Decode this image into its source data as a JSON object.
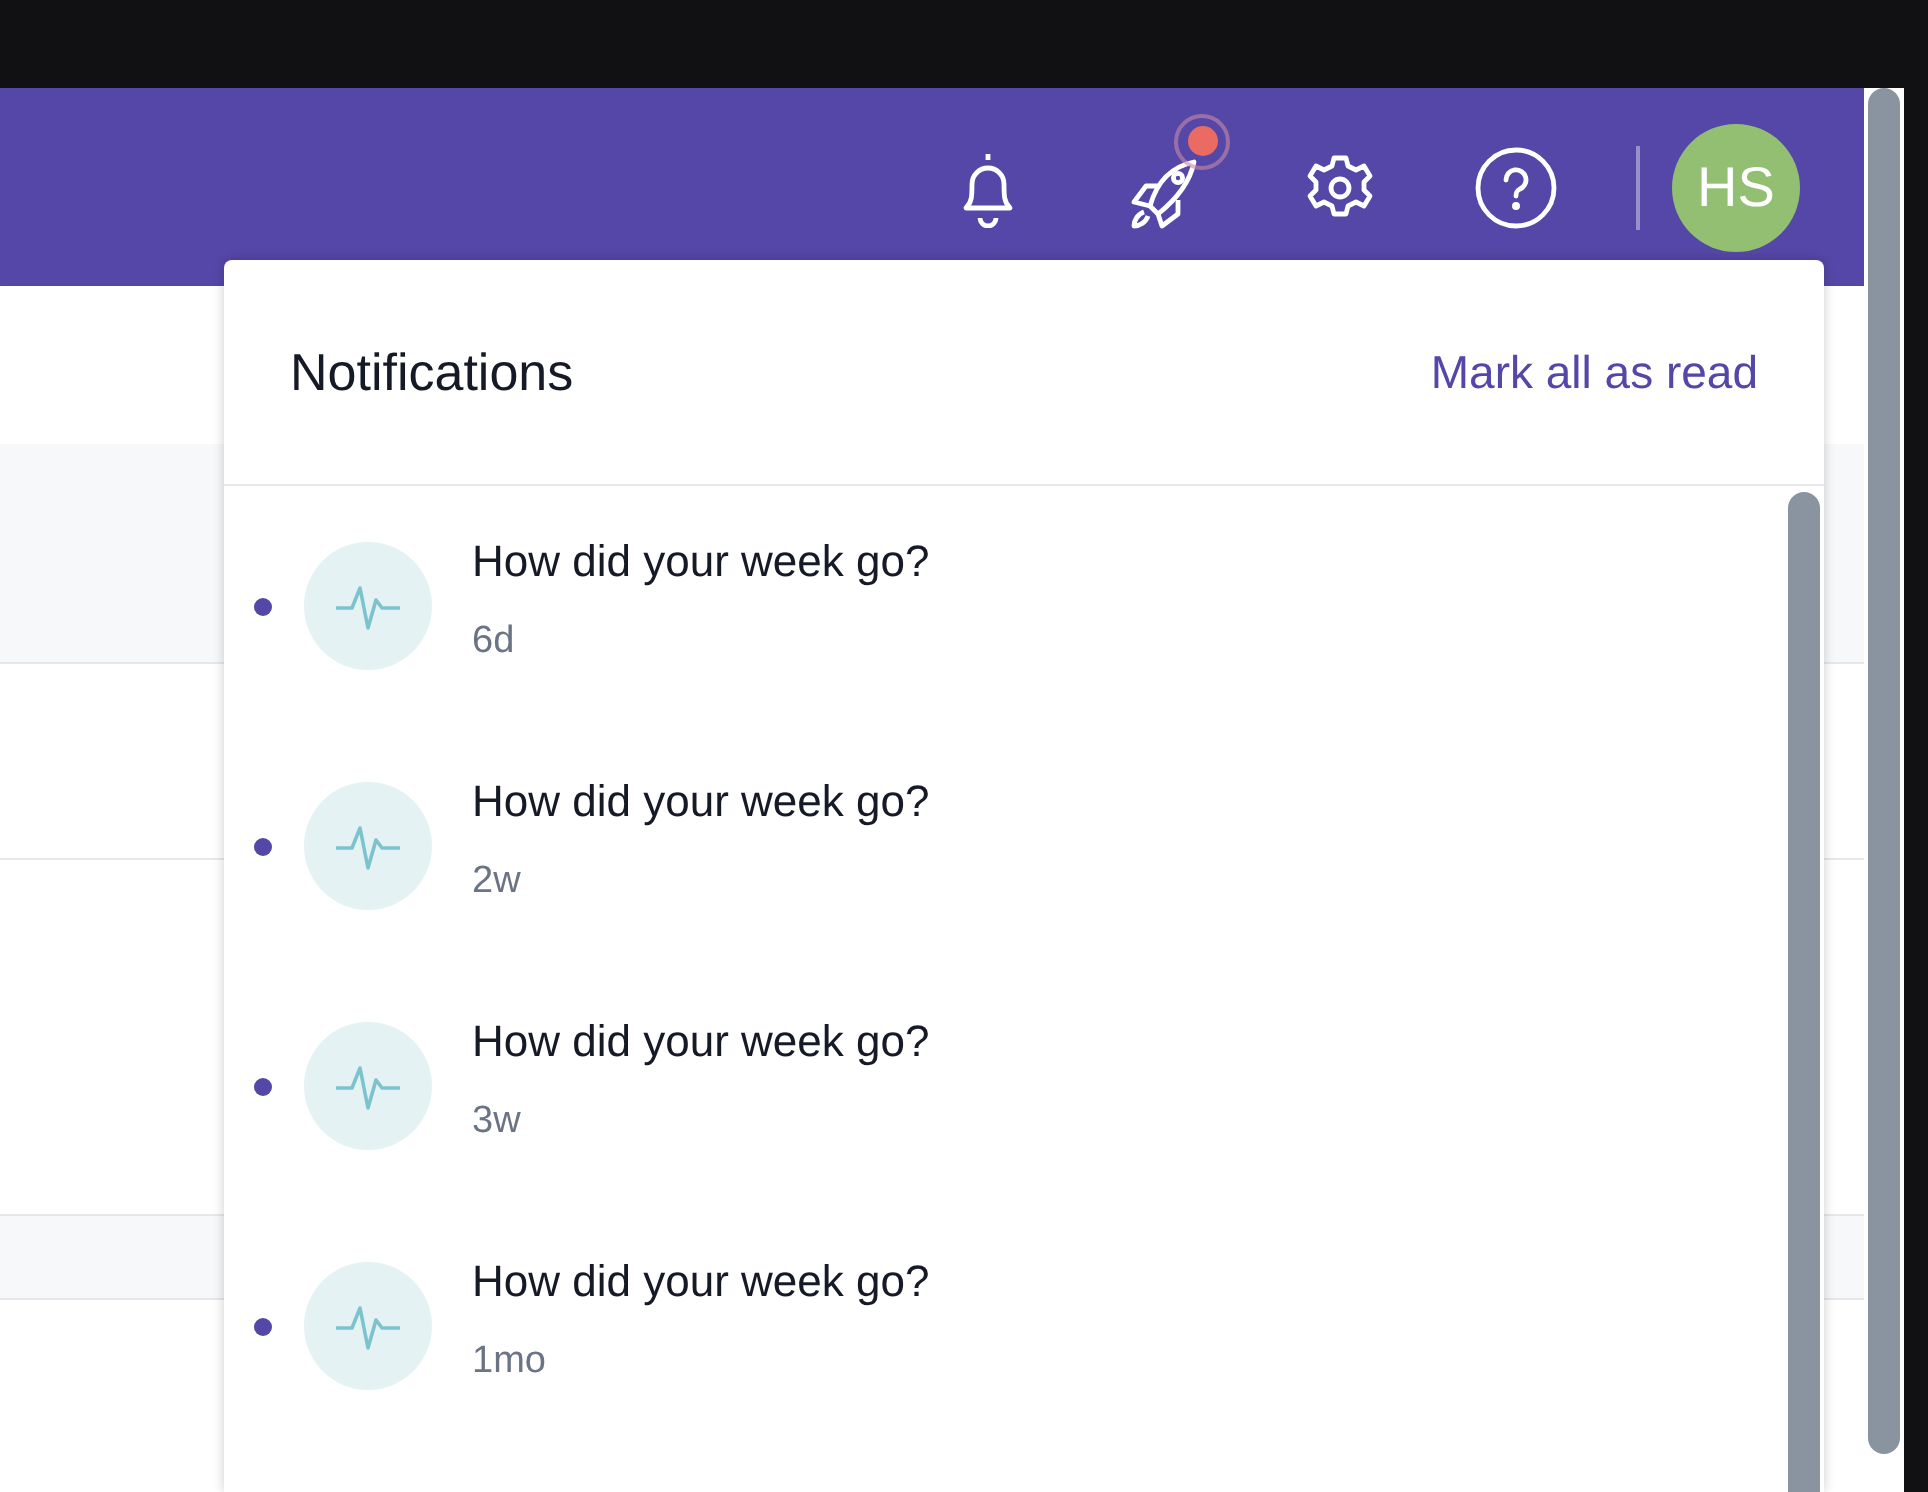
{
  "header": {
    "actions": [
      {
        "kind": "bell"
      },
      {
        "kind": "rocket",
        "badge": true
      },
      {
        "kind": "gear"
      },
      {
        "kind": "help"
      }
    ],
    "avatar": {
      "initials": "HS",
      "color": "#93bf72"
    }
  },
  "notifications": {
    "title": "Notifications",
    "mark_all": "Mark all as read",
    "items": [
      {
        "title": "How did your week go?",
        "time": "6d",
        "unread": true
      },
      {
        "title": "How did your week go?",
        "time": "2w",
        "unread": true
      },
      {
        "title": "How did your week go?",
        "time": "3w",
        "unread": true
      },
      {
        "title": "How did your week go?",
        "time": "1mo",
        "unread": true
      }
    ]
  }
}
